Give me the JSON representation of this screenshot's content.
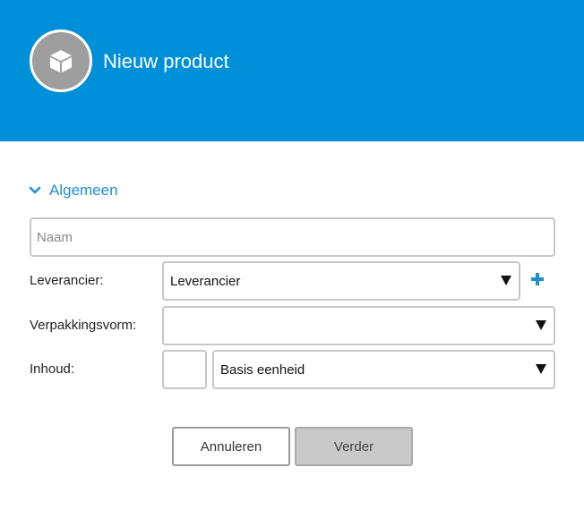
{
  "header": {
    "title": "Nieuw product",
    "avatar_icon": "box-icon",
    "background_color": "#0090da"
  },
  "section": {
    "label": "Algemeen",
    "expanded": true,
    "icon": "chevron-down-icon"
  },
  "fields": {
    "name": {
      "placeholder": "Naam",
      "value": ""
    },
    "supplier": {
      "label": "Leverancier:",
      "selected": "Leverancier",
      "add_icon": "plus-icon"
    },
    "packaging": {
      "label": "Verpakkingsvorm:",
      "selected": ""
    },
    "content": {
      "label": "Inhoud:",
      "quantity": "",
      "unit_selected": "Basis eenheid"
    }
  },
  "buttons": {
    "cancel": "Annuleren",
    "next": "Verder"
  },
  "colors": {
    "accent": "#1f8fd0",
    "header": "#0090da",
    "disabled_button": "#c9c9c9"
  }
}
